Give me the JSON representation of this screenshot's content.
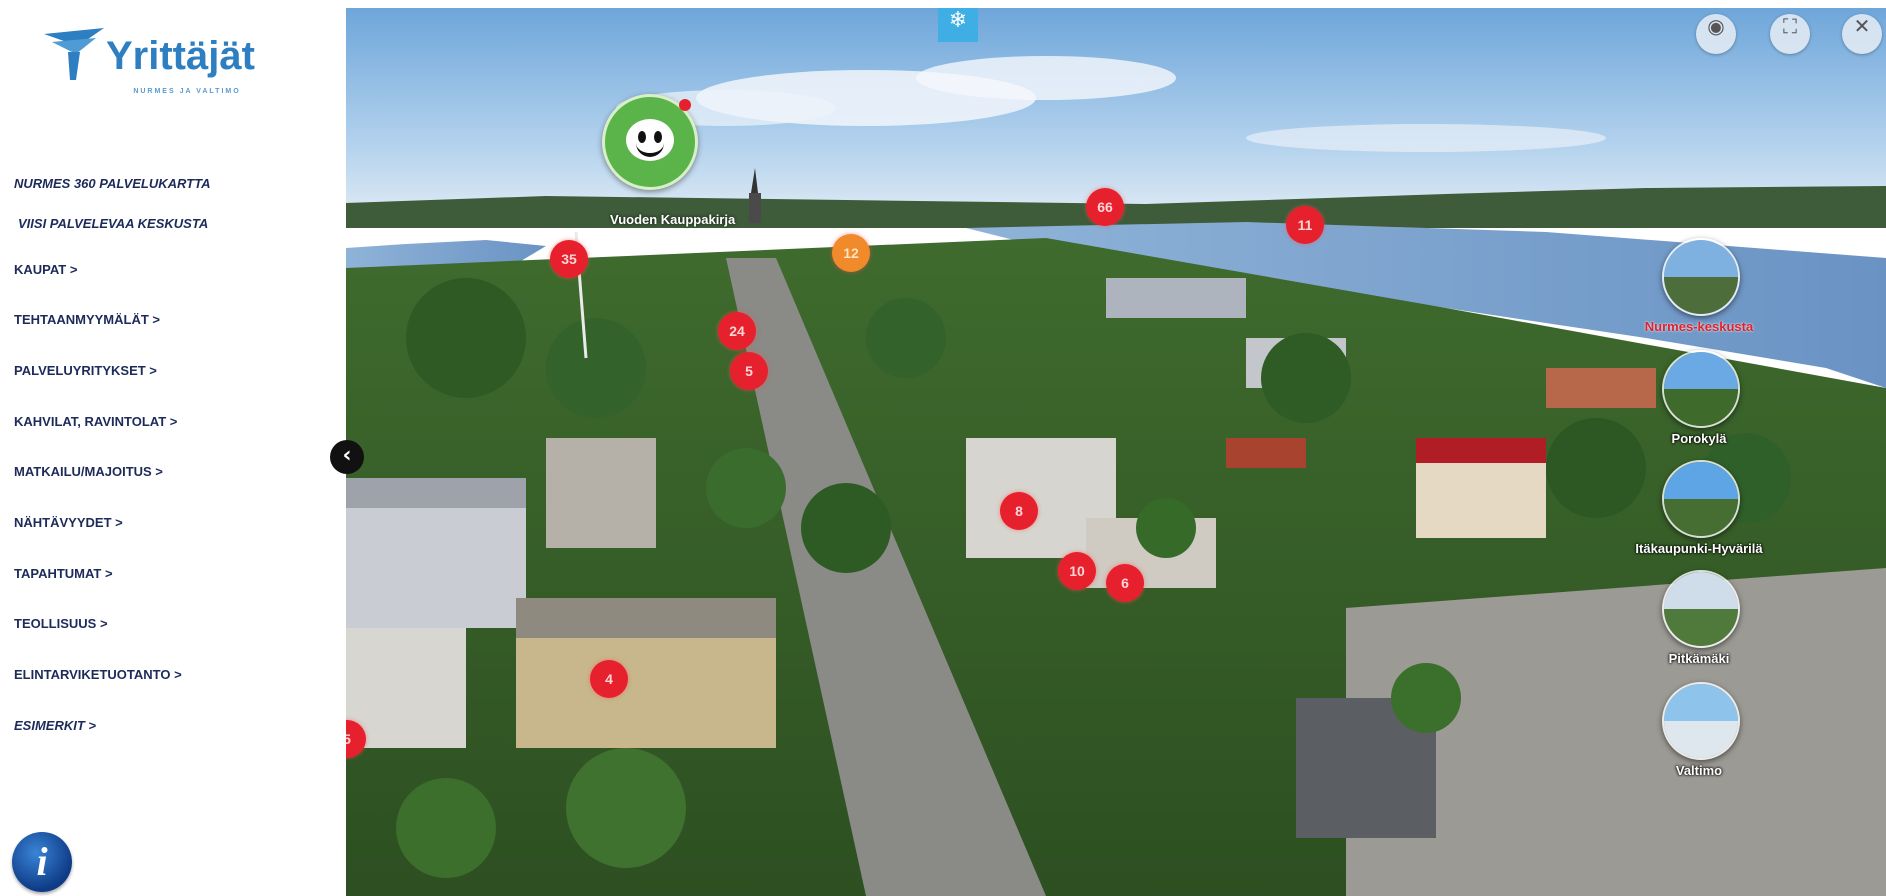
{
  "sidebar": {
    "logo": {
      "brand": "Yrittäjät",
      "tagline": "NURMES JA VALTIMO"
    },
    "menu": [
      "NURMES 360 PALVELUKARTTA",
      "VIISI PALVELEVAA KESKUSTA",
      "KAUPAT >",
      "TEHTAANMYYMÄLÄT >",
      "PALVELUYRITYKSET >",
      "KAHVILAT, RAVINTOLAT >",
      "MATKAILU/MAJOITUS >",
      "NÄHTÄVYYDET >",
      "TAPAHTUMAT >",
      "TEOLLISUUS >",
      "ELINTARVIKETUOTANTO >",
      "ESIMERKIT >"
    ],
    "info_glyph": "i",
    "collapse_glyph": "‹"
  },
  "viewer": {
    "controls": {
      "snow_glyph": "❄",
      "vr_glyph": "◉",
      "fullscreen_glyph": "⛶",
      "close_glyph": "✕"
    },
    "poi_label": "Vuoden Kauppakirja",
    "markers": [
      "35",
      "24",
      "5",
      "66",
      "11",
      "8",
      "10",
      "6",
      "4",
      "5",
      "12"
    ],
    "panoramas": [
      {
        "label": "Nurmes-keskusta",
        "active": true
      },
      {
        "label": "Porokylä",
        "active": false
      },
      {
        "label": "Itäkaupunki-Hyvärilä",
        "active": false
      },
      {
        "label": "Pitkämäki",
        "active": false
      },
      {
        "label": "Valtimo",
        "active": false
      }
    ],
    "mascot": {
      "icon": "smiley-mascot"
    }
  },
  "colors": {
    "brand": "#2e7fc1",
    "menu_text": "#1d2b5a",
    "marker_red": "#e6202d",
    "marker_orange": "#f08a2a",
    "snow_badge": "#3eaee5"
  }
}
